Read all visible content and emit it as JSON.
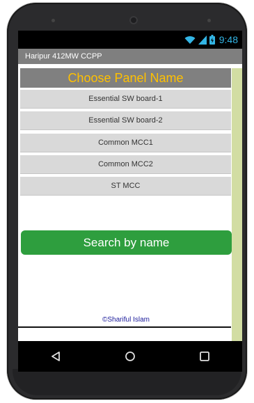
{
  "statusbar": {
    "time": "9:48"
  },
  "app": {
    "title": "Haripur 412MW CCPP"
  },
  "panel": {
    "header": "Choose Panel Name",
    "items": [
      "Essential SW board-1",
      "Essential SW board-2",
      "Common MCC1",
      "Common MCC2",
      "ST MCC"
    ]
  },
  "search_button": "Search by name",
  "credit": "©Shariful Islam",
  "icons": {
    "wifi": "wifi-icon",
    "signal": "signal-icon",
    "battery": "battery-icon",
    "back": "back-icon",
    "home": "home-icon",
    "recents": "recents-icon"
  },
  "colors": {
    "header_text": "#ffc000",
    "button": "#2e9e3e",
    "status_text": "#33b5e5",
    "credit_text": "#1a1a9a"
  }
}
